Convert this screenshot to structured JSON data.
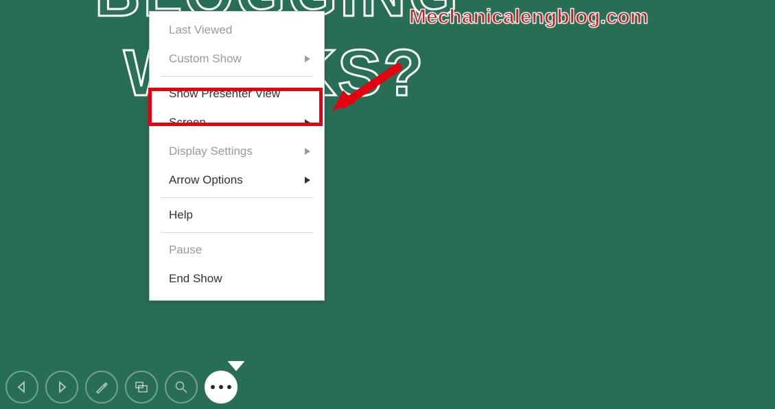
{
  "background": {
    "line1": "BLOGGING",
    "line2": "WORKS?"
  },
  "watermark": "Mechanicalengblog.com",
  "menu": {
    "last_viewed": "Last Viewed",
    "custom_show": "Custom Show",
    "show_presenter_view": "Show Presenter View",
    "screen": "Screen",
    "display_settings": "Display Settings",
    "arrow_options": "Arrow Options",
    "help": "Help",
    "pause": "Pause",
    "end_show": "End Show"
  }
}
